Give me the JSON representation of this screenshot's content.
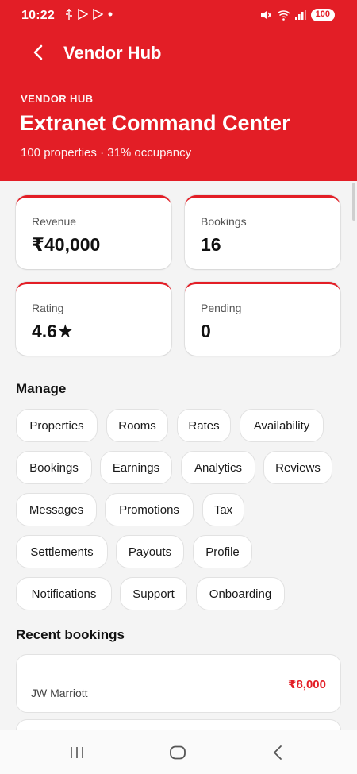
{
  "status": {
    "time": "10:22",
    "battery": "100"
  },
  "appbar": {
    "title": "Vendor Hub"
  },
  "hero": {
    "eyebrow": "VENDOR HUB",
    "title": "Extranet Command Center",
    "subtitle": "100 properties · 31% occupancy"
  },
  "stats": [
    {
      "label": "Revenue",
      "value": "₹40,000"
    },
    {
      "label": "Bookings",
      "value": "16"
    },
    {
      "label": "Rating",
      "value": "4.6★"
    },
    {
      "label": "Pending",
      "value": "0"
    }
  ],
  "manage": {
    "title": "Manage",
    "items": [
      "Properties",
      "Rooms",
      "Rates",
      "Availability",
      "Bookings",
      "Earnings",
      "Analytics",
      "Reviews",
      "Messages",
      "Promotions",
      "Tax",
      "Settlements",
      "Payouts",
      "Profile",
      "Notifications",
      "Support",
      "Onboarding"
    ]
  },
  "recent": {
    "title": "Recent bookings",
    "items": [
      {
        "name": "JW Marriott",
        "amount": "₹8,000"
      }
    ]
  },
  "colors": {
    "brand": "#e31e26",
    "background": "#f4f4f4"
  },
  "icons": {
    "back": "chevron-left-icon",
    "nav_recents": "recents-icon",
    "nav_home": "home-icon",
    "nav_back": "nav-back-icon"
  }
}
